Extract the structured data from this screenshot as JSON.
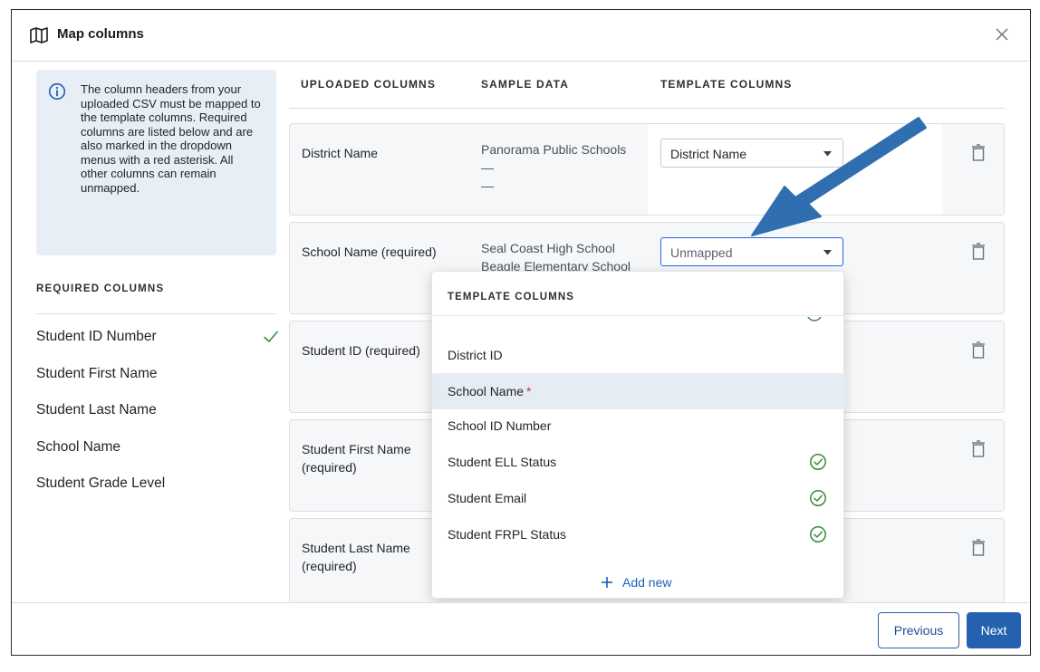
{
  "modal": {
    "title": "Map columns"
  },
  "info_box": {
    "text": "The column headers from your uploaded CSV must be mapped to the template columns. Required columns are listed below and are also marked in the dropdown menus with a red asterisk. All other columns can remain unmapped."
  },
  "required_columns": {
    "heading": "REQUIRED COLUMNS",
    "items": [
      {
        "label": "Student ID Number",
        "mapped": true
      },
      {
        "label": "Student First Name",
        "mapped": false
      },
      {
        "label": "Student Last Name",
        "mapped": false
      },
      {
        "label": "School Name",
        "mapped": false
      },
      {
        "label": "Student Grade Level",
        "mapped": false
      }
    ]
  },
  "table": {
    "headers": {
      "uploaded": "UPLOADED COLUMNS",
      "sample": "SAMPLE DATA",
      "template": "TEMPLATE COLUMNS"
    },
    "rows": [
      {
        "uploaded": "District Name",
        "sample": [
          "Panorama Public Schools",
          "—",
          "—"
        ],
        "template_value": "District Name"
      },
      {
        "uploaded": "School Name (required)",
        "sample": [
          "Seal Coast High School",
          "Beagle Elementary School"
        ],
        "template_value": "Unmapped"
      },
      {
        "uploaded": "Student ID (required)",
        "sample": [],
        "template_value": ""
      },
      {
        "uploaded": "Student First Name (required)",
        "sample": [],
        "template_value": ""
      },
      {
        "uploaded": "Student Last Name (required)",
        "sample": [],
        "template_value": ""
      }
    ]
  },
  "dropdown": {
    "heading": "TEMPLATE COLUMNS",
    "items": [
      {
        "label": "District ID",
        "required": false,
        "mapped": false
      },
      {
        "label": "School Name",
        "required": true,
        "mapped": false,
        "highlighted": true
      },
      {
        "label": "School ID Number",
        "required": false,
        "mapped": false
      },
      {
        "label": "Student ELL Status",
        "required": false,
        "mapped": true
      },
      {
        "label": "Student Email",
        "required": false,
        "mapped": true
      },
      {
        "label": "Student FRPL Status",
        "required": false,
        "mapped": true
      }
    ],
    "add_new_label": "Add new",
    "required_marker": "*"
  },
  "footer": {
    "previous_label": "Previous",
    "next_label": "Next"
  },
  "colors": {
    "accent": "#2462b0",
    "success": "#3a8a3a",
    "required": "#d0342c",
    "annotation_arrow": "#2f6fb0"
  }
}
